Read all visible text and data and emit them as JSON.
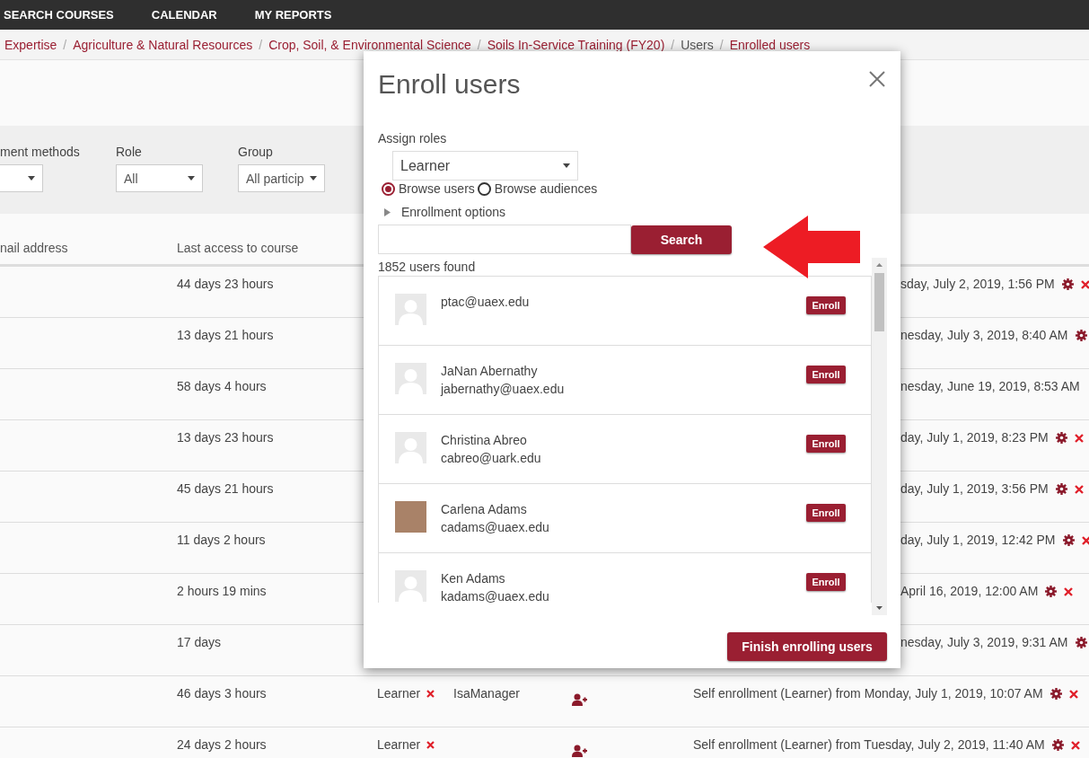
{
  "nav": {
    "items": [
      "SEARCH COURSES",
      "CALENDAR",
      "MY REPORTS"
    ]
  },
  "breadcrumb": [
    {
      "label": "Expertise",
      "link": true
    },
    {
      "separator": "/",
      "label": "Agriculture & Natural Resources",
      "link": true
    },
    {
      "separator": "/",
      "label": "Crop, Soil, & Environmental Science",
      "link": true
    },
    {
      "separator": "/",
      "label": "Soils In-Service Training (FY20)",
      "link": true
    },
    {
      "separator": "/",
      "label": "Users",
      "link": false
    },
    {
      "separator": "/",
      "label": "Enrolled users",
      "link": true
    }
  ],
  "filters": [
    {
      "label": "ment methods"
    },
    {
      "label": "Role",
      "value": "All"
    },
    {
      "label": "Group",
      "value": "All particip"
    }
  ],
  "table": {
    "columns": [
      "nail address",
      "Last access to course"
    ],
    "rows": [
      {
        "kind": "partial",
        "last_access": "44 days 23 hours",
        "status": "sday, July 2, 2019, 1:56 PM",
        "gear": true,
        "delete": true
      },
      {
        "kind": "partial",
        "last_access": "13 days 21 hours",
        "status": "nesday, July 3, 2019, 8:40 AM",
        "gear": true,
        "delete": false
      },
      {
        "kind": "partial",
        "last_access": "58 days 4 hours",
        "status": "nesday, June 19, 2019, 8:53 AM",
        "gear": false,
        "delete": false
      },
      {
        "kind": "partial",
        "last_access": "13 days 23 hours",
        "status": "day, July 1, 2019, 8:23 PM",
        "gear": true,
        "delete": true
      },
      {
        "kind": "partial",
        "last_access": "45 days 21 hours",
        "status": "day, July 1, 2019, 3:56 PM",
        "gear": true,
        "delete": true
      },
      {
        "kind": "partial",
        "last_access": "11 days 2 hours",
        "status": "day, July 1, 2019, 12:42 PM",
        "gear": true,
        "delete": true
      },
      {
        "kind": "partial",
        "last_access": "2 hours 19 mins",
        "status": "April 16, 2019, 12:00 AM",
        "gear": true,
        "delete": true
      },
      {
        "kind": "partial",
        "last_access": "17 days",
        "status": "nesday, July 3, 2019, 9:31 AM",
        "gear": true,
        "delete": false
      },
      {
        "kind": "full",
        "last_access": "46 days 3 hours",
        "role": "Learner",
        "group": "IsaManager",
        "status": "Self enrollment (Learner) from Monday, July 1, 2019, 10:07 AM",
        "gear": true,
        "delete": true
      },
      {
        "kind": "full",
        "last_access": "24 days 2 hours",
        "role": "Learner",
        "status": "Self enrollment (Learner) from Tuesday, July 2, 2019, 11:40 AM",
        "gear": true,
        "delete": true
      }
    ]
  },
  "dialog": {
    "title": "Enroll users",
    "assign_roles_label": "Assign roles",
    "role_select": "Learner",
    "radios": [
      {
        "label": "Browse users",
        "selected": true
      },
      {
        "label": "Browse audiences",
        "selected": false
      }
    ],
    "enrollment_options": {
      "label": "Enrollment options",
      "expanded": false
    },
    "search_button": "Search",
    "found": "1852 users found",
    "users": [
      {
        "email": "ptac@uaex.edu",
        "has_photo": false,
        "button": "Enroll"
      },
      {
        "name": "JaNan Abernathy",
        "email": "jabernathy@uaex.edu",
        "has_photo": false,
        "button": "Enroll"
      },
      {
        "name": "Christina Abreo",
        "email": "cabreo@uark.edu",
        "has_photo": false,
        "button": "Enroll"
      },
      {
        "name": "Carlena Adams",
        "email": "cadams@uaex.edu",
        "has_photo": true,
        "button": "Enroll"
      },
      {
        "name": "Ken Adams",
        "email": "kadams@uaex.edu",
        "has_photo": false,
        "button": "Enroll"
      }
    ],
    "finish_button": "Finish enrolling users"
  }
}
